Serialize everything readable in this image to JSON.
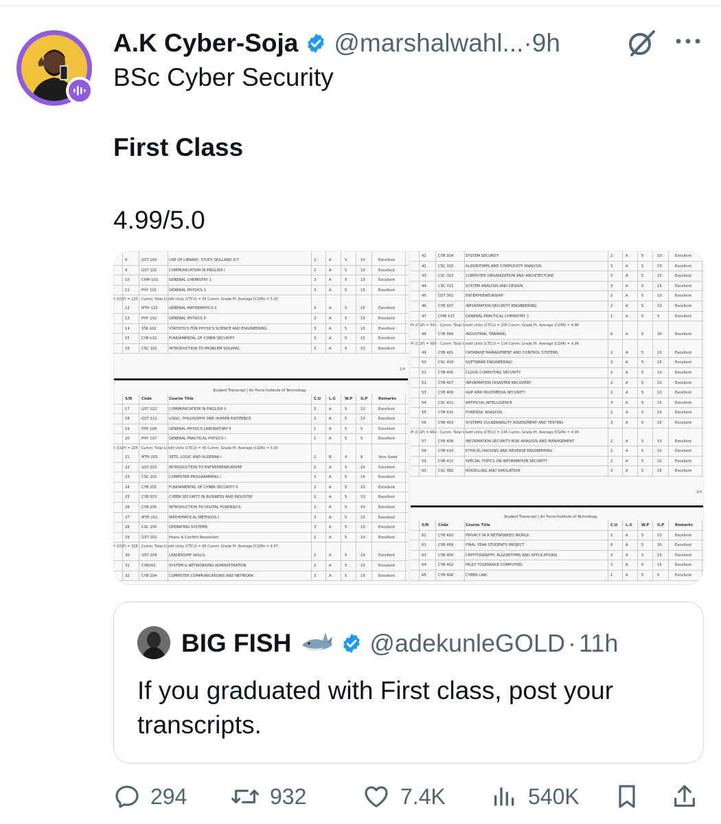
{
  "tweet": {
    "display_name": "A.K Cyber-Soja",
    "handle": "@marshalwahl...",
    "separator": "·",
    "time": "9h",
    "lines": [
      "BSc Cyber Security",
      "First Class",
      "4.99/5.0"
    ],
    "icons": {
      "verified": "verified-badge-icon",
      "grok": "grok-icon",
      "more": "more-icon",
      "spaces": "spaces-badge-icon"
    }
  },
  "colors": {
    "accent": "#1d9bf0",
    "secondary_text": "#536471",
    "spaces_ring": "#8f5be0",
    "border": "#cfd9de"
  },
  "transcript_left": {
    "rows_top": [
      [
        "8",
        "GST 105",
        "USE OF LIBRARY, STUDY SKILLAND ICT",
        "2",
        "A",
        "5",
        "10",
        "Excellent"
      ],
      [
        "9",
        "GST 101",
        "COMMUNICATION IN ENGLISH I",
        "2",
        "A",
        "5",
        "10",
        "Excellent"
      ],
      [
        "10",
        "CHM 101",
        "GENERAL CHEMISTRY 1",
        "3",
        "A",
        "5",
        "15",
        "Excellent"
      ],
      [
        "11",
        "PHY 101",
        "GENERAL PHYSICS 1",
        "3",
        "A",
        "5",
        "15",
        "Excellent"
      ]
    ],
    "note1": "t (CGP) = 125 - Cumm. Total Credit Units (CTCU) = 25 Cumm. Grade Pt. Average (CGPA) = 5.00",
    "rows_mid": [
      [
        "12",
        "MTH 122",
        "GENERAL MATHEMATICS II",
        "3",
        "A",
        "5",
        "15",
        "Excellent"
      ],
      [
        "13",
        "PHY 102",
        "GENERAL PHYSICS II",
        "3",
        "A",
        "5",
        "15",
        "Excellent"
      ],
      [
        "14",
        "STA 102",
        "STATISTICS FOR PHYSICS SCIENCE AND ENGINEERING",
        "3",
        "A",
        "5",
        "15",
        "Excellent"
      ],
      [
        "15",
        "CYB 102",
        "FUNDAMENTAL OF CYBER SECURITY",
        "3",
        "A",
        "5",
        "15",
        "Excellent"
      ],
      [
        "16",
        "CSC 102",
        "INTRODUCTION TO PROBLEM SOLVING",
        "2",
        "A",
        "5",
        "10",
        "Excellent"
      ]
    ],
    "page": "1/4",
    "title": "Student Transcript | Air Force Institute of Technology",
    "headers": [
      "S/N",
      "Code",
      "Course Title",
      "C.U",
      "L.G",
      "W.P",
      "G.P",
      "Remarks"
    ],
    "rows_p2a": [
      [
        "17",
        "GST 122",
        "COMMUNICATION IN ENGLISH II",
        "2",
        "A",
        "5",
        "10",
        "Excellent"
      ],
      [
        "18",
        "GST 112",
        "LOGIC, PHILOSOPHY AND HUMAN EXISTENCE",
        "2",
        "A",
        "5",
        "10",
        "Excellent"
      ],
      [
        "19",
        "PHY 108",
        "GENERAL PHYSICS LABORATORY II",
        "1",
        "A",
        "5",
        "5",
        "Excellent"
      ],
      [
        "20",
        "PHY 107",
        "GENERAL PRACTICAL PHYSICS I",
        "1",
        "A",
        "5",
        "5",
        "Excellent"
      ]
    ],
    "note2": "t (CGP) = 225 - Cumm. Total Credit Units (CTCU) = 45 Cumm. Grade Pt. Average (CGPA) = 5.00",
    "rows_p2b": [
      [
        "21",
        "MTH 203",
        "SETS, LOGIC AND ALGEBRA I",
        "2",
        "B",
        "4",
        "8",
        "Very Good"
      ],
      [
        "22",
        "GST 201",
        "INTRODUCTION TO ENTREPRENEURSHIP",
        "2",
        "A",
        "5",
        "10",
        "Excellent"
      ],
      [
        "23",
        "CSC 201",
        "COMPUTER PROGRAMMING I",
        "3",
        "A",
        "5",
        "15",
        "Excellent"
      ],
      [
        "24",
        "CYB 201",
        "FUNDAMENTAL OF CYBER SECURITY II",
        "2",
        "A",
        "5",
        "10",
        "Excellent"
      ],
      [
        "25",
        "CYB 203",
        "CYBER SECURITY IN BUSINESS AND INDUSTRY",
        "2",
        "A",
        "5",
        "10",
        "Excellent"
      ],
      [
        "26",
        "CYB 205",
        "INTRODUCTION TO DIGITAL FORENSICS",
        "2",
        "A",
        "5",
        "10",
        "Excellent"
      ],
      [
        "27",
        "MTH 201",
        "MATHEMATICAL METHODS I",
        "3",
        "A",
        "5",
        "15",
        "Excellent"
      ],
      [
        "28",
        "CSC 205",
        "OPERATING SYSTEMS",
        "3",
        "A",
        "5",
        "15",
        "Excellent"
      ],
      [
        "29",
        "GST 202",
        "Peace & Conflict Resolution",
        "2",
        "A",
        "5",
        "10",
        "Excellent"
      ]
    ],
    "note3": "t (CGP) = 328 - Cumm. Total Credit Units (CTCU) = 66 Cumm. Grade Pt. Average (CGPA) = 4.97",
    "rows_p2c": [
      [
        "30",
        "GST 204",
        "LEADERSHIP SKILLS",
        "2",
        "A",
        "5",
        "10",
        "Excellent"
      ],
      [
        "31",
        "CYB202",
        "SYSTEM & NETWORKING ADMINISTRATION",
        "2",
        "A",
        "5",
        "10",
        "Excellent"
      ],
      [
        "32",
        "CYB 204",
        "COMPUTER COMMUNICATIONS AND NETWORK",
        "3",
        "A",
        "5",
        "15",
        "Excellent"
      ]
    ]
  },
  "transcript_right": {
    "rows_a": [
      [
        "41",
        "CYB 309",
        "SYSTEM SECURITY",
        "2",
        "A",
        "5",
        "10",
        "Excellent"
      ],
      [
        "42",
        "CSC 310",
        "ALGORITHMS AND COMPLEXITY ANALYSIS",
        "3",
        "A",
        "5",
        "15",
        "Excellent"
      ],
      [
        "43",
        "CSC 315",
        "COMPUTER ORGANIZATION AND ARCHITECTURE",
        "3",
        "A",
        "5",
        "15",
        "Excellent"
      ],
      [
        "44",
        "CSC 321",
        "SYSTEM ANALYSIS AND DESIGN",
        "3",
        "A",
        "5",
        "15",
        "Excellent"
      ],
      [
        "45",
        "GST 301",
        "ENTERPRENEURSHIP",
        "2",
        "A",
        "5",
        "10",
        "Excellent"
      ],
      [
        "46",
        "CYB 307",
        "INFORMATION SECURITY ENGINEERING",
        "2",
        "A",
        "5",
        "10",
        "Excellent"
      ],
      [
        "47",
        "CHM 107",
        "GENERAL PRACTICAL CHEMISTRY 1",
        "1",
        "A",
        "5",
        "5",
        "Excellent"
      ]
    ],
    "note1": "Pt (CGP) = 543 - Cumm. Total Credit Units (CTCU) = 109 Cumm. Grade Pt. Average (CGPA) = 4.98",
    "rows_b": [
      [
        "48",
        "CYB 399",
        "INDUSTRIAL TRAINING",
        "6",
        "A",
        "5",
        "30",
        "Excellent"
      ]
    ],
    "note2": "Pt (CGP) = 568 - Cumm. Total Credit Units (CTCU) = 114 Cumm. Grade Pt. Average (CGPA) = 4.98",
    "rows_c": [
      [
        "49",
        "CYB 401",
        "DATABASE MANAGEMENT AND CONTROL SYSTEMS",
        "2",
        "A",
        "5",
        "10",
        "Excellent"
      ],
      [
        "50",
        "CSC 403",
        "SOFTWARE ENGINEERING",
        "3",
        "A",
        "5",
        "15",
        "Excellent"
      ],
      [
        "51",
        "CYB 405",
        "CLOUD COMPUTING SECURITY",
        "2",
        "A",
        "5",
        "10",
        "Excellent"
      ],
      [
        "52",
        "CYB 407",
        "INFORMATION DISASTER RECOVERY",
        "2",
        "A",
        "5",
        "10",
        "Excellent"
      ],
      [
        "53",
        "CYB 409",
        "VoIP AND MULTIMEDIA SECURITY",
        "2",
        "A",
        "5",
        "10",
        "Excellent"
      ],
      [
        "54",
        "CSC 411",
        "ARTIFICIAL INTELLIGENCE",
        "3",
        "A",
        "5",
        "15",
        "Excellent"
      ],
      [
        "55",
        "CYB 415",
        "FORENSIC ANALYSIS",
        "2",
        "A",
        "5",
        "10",
        "Excellent"
      ],
      [
        "56",
        "CYB 403",
        "SYSTEMS VULNERABILITY ASSESSMENT AND TESTING",
        "3",
        "A",
        "5",
        "15",
        "Excellent"
      ]
    ],
    "note3": "Pt (CGP) = 668 - Cumm. Total Credit Units (CTCU) = 134 Cumm. Grade Pt. Average (CGPA) = 4.99",
    "rows_d": [
      [
        "57",
        "CYB 408",
        "INFORMATION SECURITY RISK ANALYSIS AND MANAGEMENT",
        "2",
        "A",
        "5",
        "10",
        "Excellent"
      ],
      [
        "58",
        "CYB 410",
        "ETHICAL HACKING AND REVERSE ENGINEERING",
        "2",
        "A",
        "5",
        "10",
        "Excellent"
      ],
      [
        "59",
        "CYB 412",
        "SPECIAL TOPICS ON INFORMATION SECURITY",
        "2",
        "A",
        "5",
        "10",
        "Excellent"
      ],
      [
        "60",
        "CSC 482",
        "MODELLING AND SIMULATION",
        "3",
        "A",
        "5",
        "15",
        "Excellent"
      ]
    ],
    "page": "3/4",
    "title": "Student Transcript | Air Force Institute of Technology",
    "headers": [
      "S/N",
      "Code",
      "Course Title",
      "C.U",
      "L.G",
      "W.P",
      "G.P",
      "Remarks"
    ],
    "rows_e": [
      [
        "61",
        "CYB 420",
        "PRIVACY IN A NETWORKED WORLD",
        "2",
        "A",
        "5",
        "10",
        "Excellent"
      ],
      [
        "62",
        "CYB 499",
        "FINAL YEAR STUDENTS PROJECT",
        "6",
        "A",
        "5",
        "30",
        "Excellent"
      ],
      [
        "63",
        "CYB 404",
        "CRYPTOGRAPHY: ALGORITHMS AND APPLICATIONS",
        "3",
        "A",
        "5",
        "15",
        "Excellent"
      ],
      [
        "64",
        "CYB 402",
        "FAULT TOLERANCE COMPUTING",
        "3",
        "A",
        "5",
        "15",
        "Excellent"
      ],
      [
        "65",
        "CYB 406",
        "CYBER LAW",
        "1",
        "A",
        "5",
        "5",
        "Excellent"
      ]
    ]
  },
  "quote": {
    "display_name": "BIG FISH",
    "emoji_icon": "shark-icon",
    "handle": "@adekunleGOLD",
    "separator": "·",
    "time": "11h",
    "text": "If you graduated with First class, post your transcripts."
  },
  "actions": {
    "replies": "294",
    "reposts": "932",
    "likes": "7.4K",
    "views": "540K"
  }
}
